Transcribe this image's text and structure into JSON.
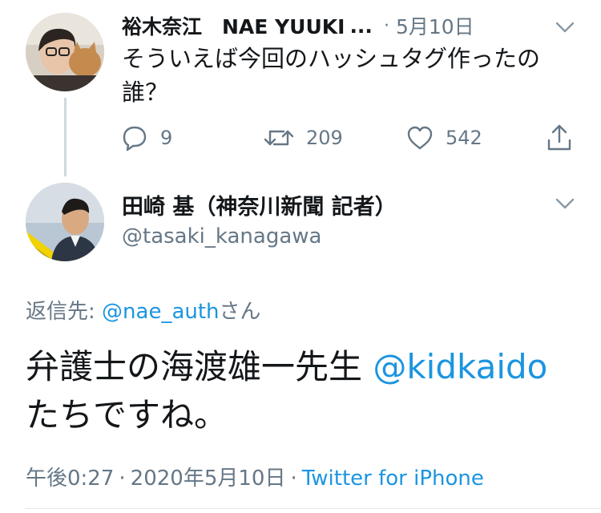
{
  "tweet1": {
    "name": "裕木奈江　NAE YUUKI",
    "ellipsis": "...",
    "dot": "·",
    "date": "5月10日",
    "body_line1": "そういえば今回のハッシュタグ作ったの",
    "body_line2": "誰？",
    "reply_count": "9",
    "retweet_count": "209",
    "like_count": "542"
  },
  "tweet2": {
    "name": "田崎 基（神奈川新聞 記者）",
    "handle": "@tasaki_kanagawa",
    "reply_to_label": "返信先: ",
    "reply_to_mention": "@nae_auth",
    "reply_to_suffix": "さん",
    "body_text1": "弁護士の海渡雄一先生 ",
    "body_mention": "@kidkaido",
    "body_text2": "たちですね。",
    "time": "午後0:27",
    "date": "2020年5月10日",
    "source": "Twitter for iPhone",
    "sep": "·"
  },
  "icons": [
    "reply-icon",
    "retweet-icon",
    "like-icon",
    "share-icon",
    "chevron-down-icon"
  ],
  "colors": {
    "link": "#1b95e0",
    "secondary_text": "#657786",
    "primary_text": "#14171a",
    "thread_line": "#cfd9de"
  }
}
